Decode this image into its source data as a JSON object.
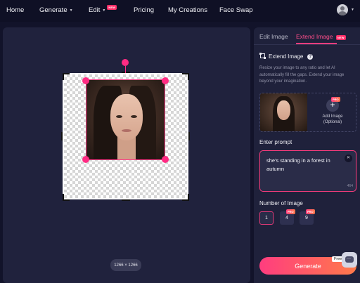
{
  "nav": {
    "home": "Home",
    "generate": "Generate",
    "edit": "Edit",
    "edit_badge": "NEW",
    "pricing": "Pricing",
    "my_creations": "My Creations",
    "face_swap": "Face Swap",
    "avatar_icon": "user-avatar-icon"
  },
  "canvas": {
    "dimensions": "1266 × 1266"
  },
  "panel": {
    "tabs": [
      {
        "label": "Edit Image",
        "active": false
      },
      {
        "label": "Extend Image",
        "active": true,
        "badge": "NEW"
      }
    ],
    "extend_title": "Extend Image",
    "help": "?",
    "description": "Resize your image to any ratio and let AI automatically fill the gaps. Extend your image beyond your imagination.",
    "add_image_badge": "PRO",
    "add_image_label": "Add Image (Optional)",
    "prompt_title": "Enter prompt",
    "prompt_value": "she's standing in a forest in autumn",
    "prompt_counter": "464",
    "number_title": "Number of Image",
    "number_options": [
      {
        "label": "1",
        "selected": true,
        "badge": ""
      },
      {
        "label": "4",
        "selected": false,
        "badge": "PRO"
      },
      {
        "label": "9",
        "selected": false,
        "badge": "PRO"
      }
    ],
    "generate_label": "Generate",
    "free_tag": "Free"
  },
  "colors": {
    "accent": "#ff2b83",
    "background": "#12132a",
    "panel": "#1f213b"
  }
}
